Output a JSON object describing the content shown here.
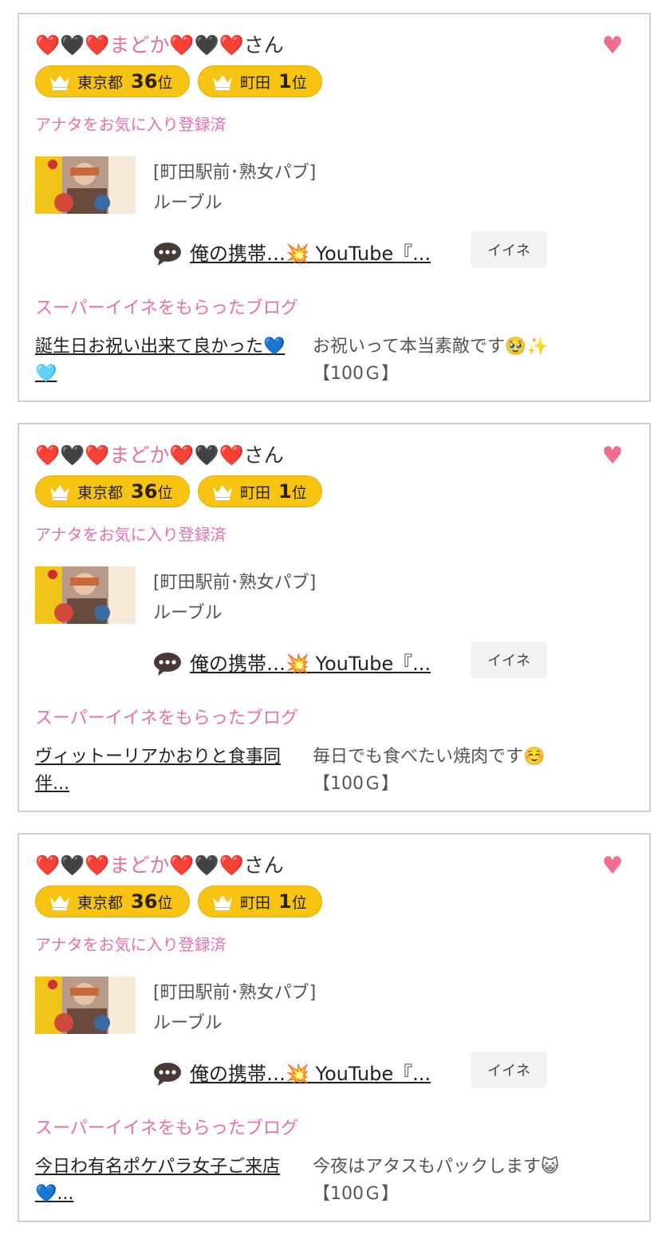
{
  "cards": [
    {
      "user": {
        "prefix": "❤️🖤❤️",
        "name": "まどか",
        "suffix_hearts": "❤️🖤❤️",
        "honorific": "さん"
      },
      "badges": [
        {
          "area": "東京都",
          "rank": "36",
          "suffix": "位"
        },
        {
          "area": "町田",
          "rank": "1",
          "suffix": "位"
        }
      ],
      "fav_status": "アナタをお気に入り登録済",
      "shop": {
        "category": "[町田駅前･熟女パブ]",
        "name": "ルーブル"
      },
      "blog_link": "俺の携帯…💥 YouTube『...",
      "iine_label": "イイネ",
      "super_title": "スーパーイイネをもらったブログ",
      "super_blog": {
        "title": "誕生日お祝い出来て良かった💙🩵",
        "comment": "お祝いって本当素敵です🥹✨",
        "points": "【100Ｇ】"
      }
    },
    {
      "user": {
        "prefix": "❤️🖤❤️",
        "name": "まどか",
        "suffix_hearts": "❤️🖤❤️",
        "honorific": "さん"
      },
      "badges": [
        {
          "area": "東京都",
          "rank": "36",
          "suffix": "位"
        },
        {
          "area": "町田",
          "rank": "1",
          "suffix": "位"
        }
      ],
      "fav_status": "アナタをお気に入り登録済",
      "shop": {
        "category": "[町田駅前･熟女パブ]",
        "name": "ルーブル"
      },
      "blog_link": "俺の携帯…💥 YouTube『...",
      "iine_label": "イイネ",
      "super_title": "スーパーイイネをもらったブログ",
      "super_blog": {
        "title": "ヴィットーリアかおりと食事同伴...",
        "comment": "毎日でも食べたい焼肉です☺️",
        "points": "【100Ｇ】"
      }
    },
    {
      "user": {
        "prefix": "❤️🖤❤️",
        "name": "まどか",
        "suffix_hearts": "❤️🖤❤️",
        "honorific": "さん"
      },
      "badges": [
        {
          "area": "東京都",
          "rank": "36",
          "suffix": "位"
        },
        {
          "area": "町田",
          "rank": "1",
          "suffix": "位"
        }
      ],
      "fav_status": "アナタをお気に入り登録済",
      "shop": {
        "category": "[町田駅前･熟女パブ]",
        "name": "ルーブル"
      },
      "blog_link": "俺の携帯…💥 YouTube『...",
      "iine_label": "イイネ",
      "super_title": "スーパーイイネをもらったブログ",
      "super_blog": {
        "title": "今日わ有名ポケパラ女子ご来店💙...",
        "comment": "今夜はアタスもパックします😺",
        "points": "【100Ｇ】"
      }
    }
  ],
  "icons": {
    "favorite": "heart-icon",
    "crown": "crown-icon",
    "comment": "speech-bubble-icon"
  },
  "colors": {
    "pink": "#e86fb0",
    "badge_gold": "#f8c413",
    "heart": "#f06d8f"
  }
}
